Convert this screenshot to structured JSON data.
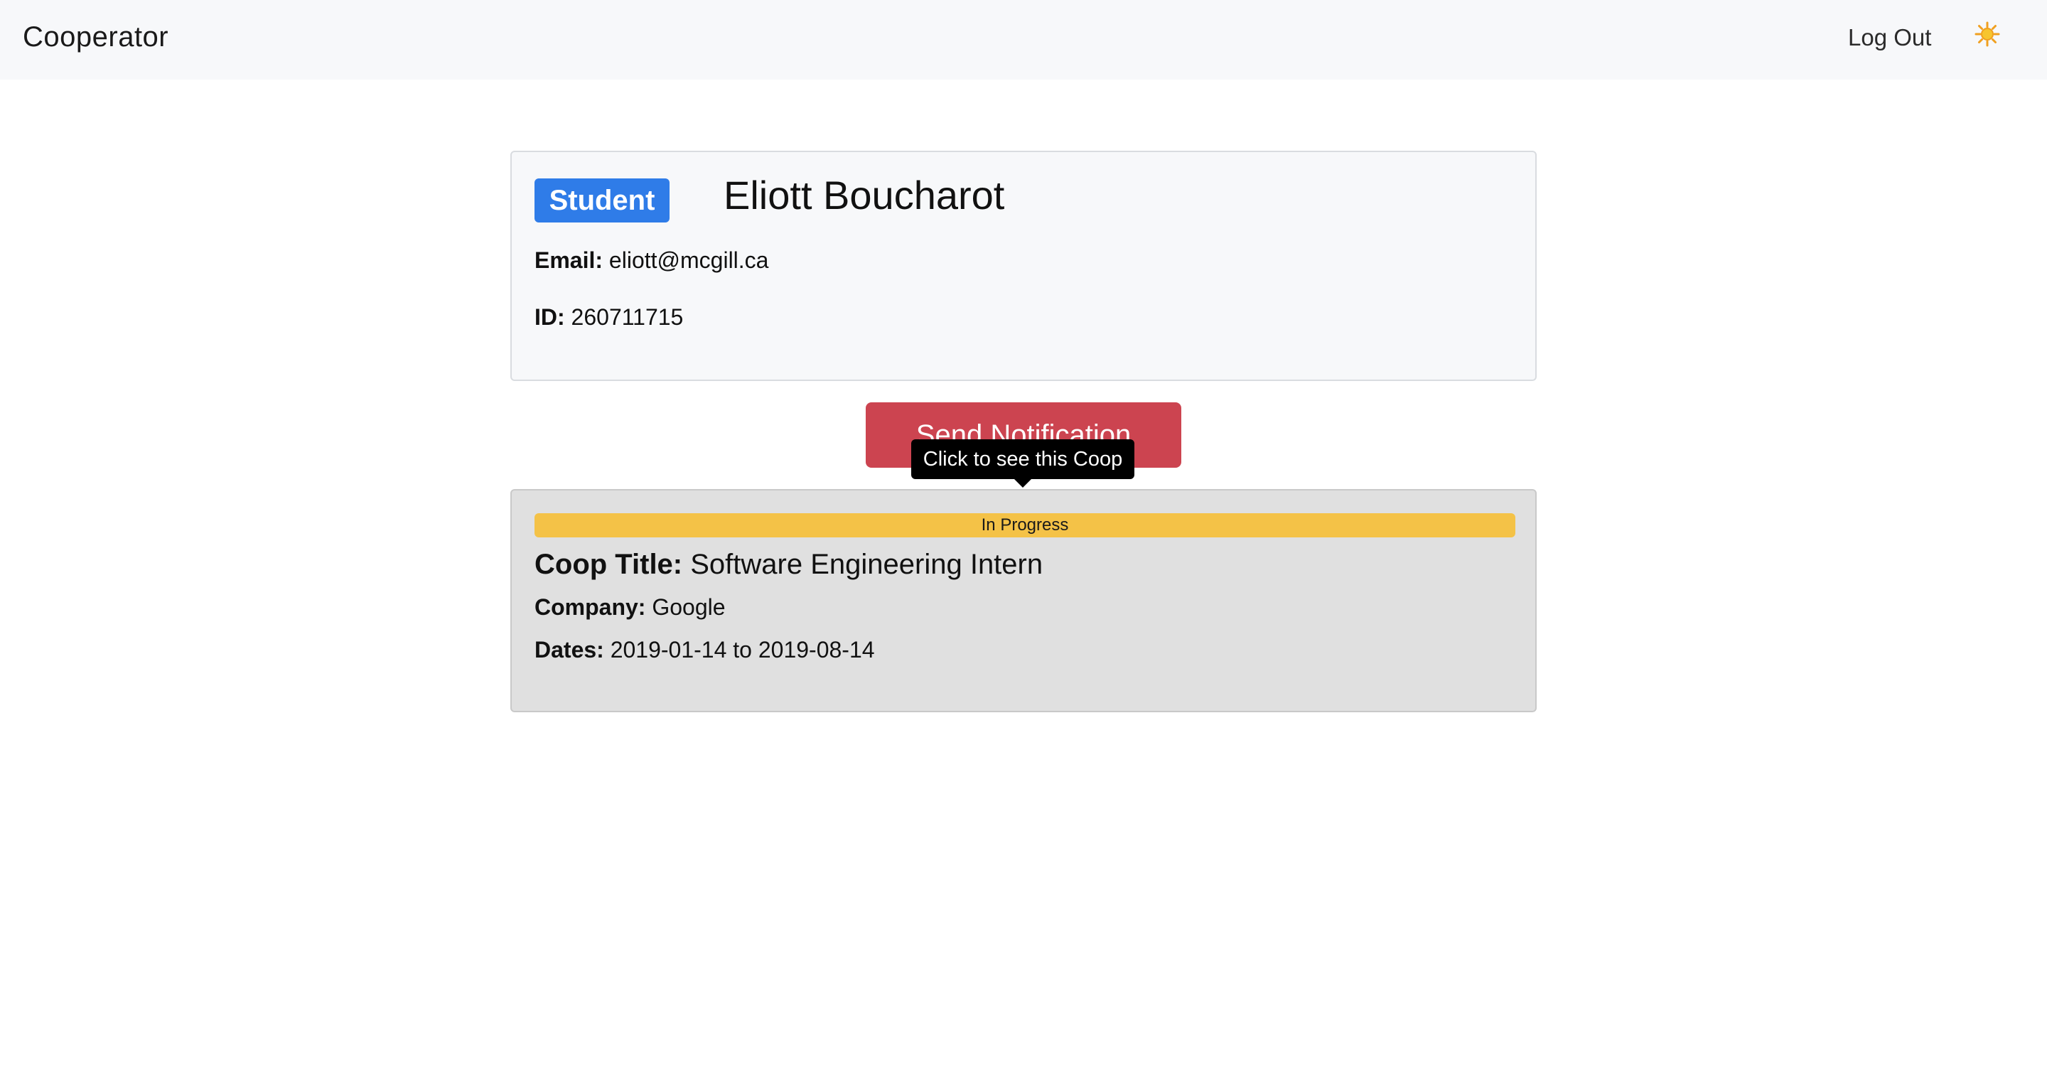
{
  "navbar": {
    "brand": "Cooperator",
    "logout_label": "Log Out",
    "theme_icon": "sun-icon"
  },
  "profile": {
    "role_badge": "Student",
    "name": "Eliott Boucharot",
    "email_label": "Email:",
    "email": "eliott@mcgill.ca",
    "id_label": "ID:",
    "id": "260711715"
  },
  "notify_button_label": "Send Notification",
  "tooltip": "Click to see this Coop",
  "coop": {
    "status": "In Progress",
    "title_label": "Coop Title:",
    "title": "Software Engineering Intern",
    "company_label": "Company:",
    "company": "Google",
    "dates_label": "Dates:",
    "dates": "2019-01-14 to 2019-08-14"
  },
  "colors": {
    "badge_blue": "#2f7ce8",
    "button_red": "#cc4450",
    "status_yellow": "#f4c247",
    "coop_card_bg": "#e0e0e0",
    "navbar_bg": "#f7f8fa"
  }
}
